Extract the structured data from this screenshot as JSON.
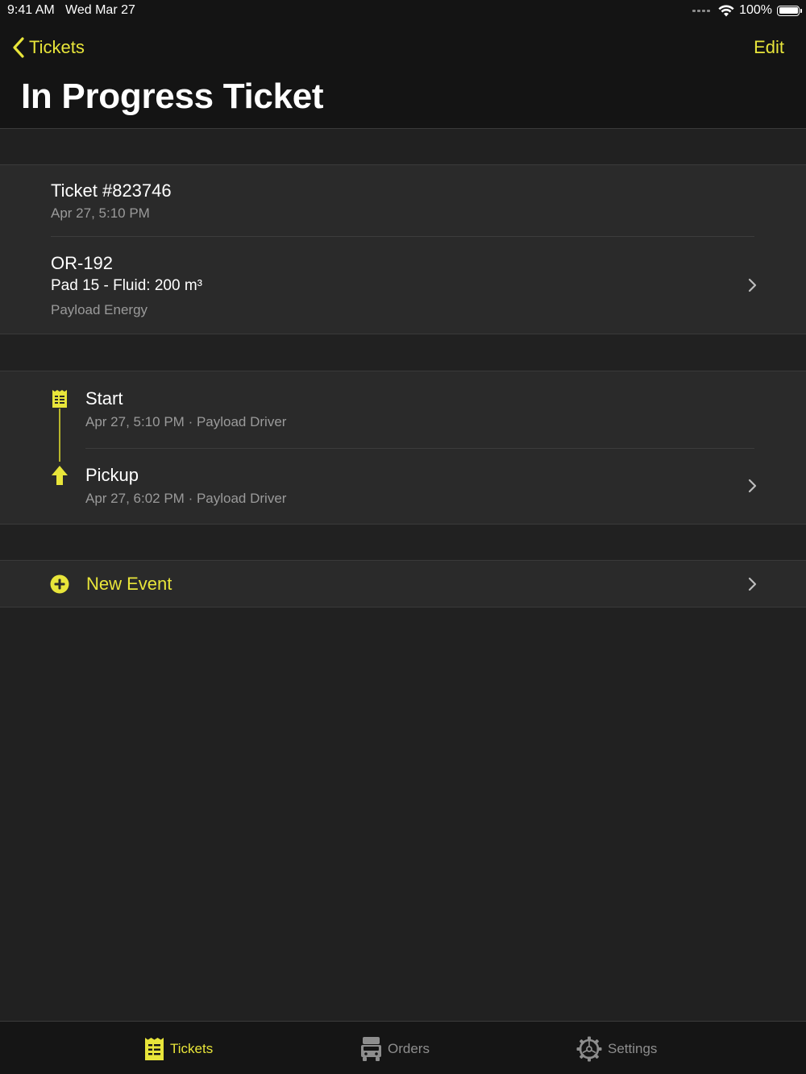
{
  "status_bar": {
    "time": "9:41 AM",
    "date": "Wed Mar 27",
    "battery": "100%"
  },
  "nav": {
    "back_label": "Tickets",
    "edit_label": "Edit",
    "title": "In Progress Ticket"
  },
  "ticket": {
    "number": "Ticket #823746",
    "created": "Apr 27, 5:10 PM"
  },
  "order": {
    "code": "OR-192",
    "detail": "Pad 15 - Fluid: 200 m³",
    "company": "Payload Energy"
  },
  "events": [
    {
      "title": "Start",
      "subtitle": "Apr 27, 5:10 PM · Payload Driver",
      "icon": "ticket-icon"
    },
    {
      "title": "Pickup",
      "subtitle": "Apr 27, 6:02 PM · Payload Driver",
      "icon": "arrow-up-icon"
    }
  ],
  "new_event": {
    "label": "New Event",
    "icon": "plus-circle-icon"
  },
  "tabs": [
    {
      "label": "Tickets",
      "icon": "ticket-icon",
      "active": true
    },
    {
      "label": "Orders",
      "icon": "truck-icon",
      "active": false
    },
    {
      "label": "Settings",
      "icon": "gear-icon",
      "active": false
    }
  ],
  "colors": {
    "accent": "#e8e53a",
    "background": "#212121",
    "cell": "#2a2a2a",
    "bar": "#141414",
    "secondary_text": "#9a9a9a"
  }
}
